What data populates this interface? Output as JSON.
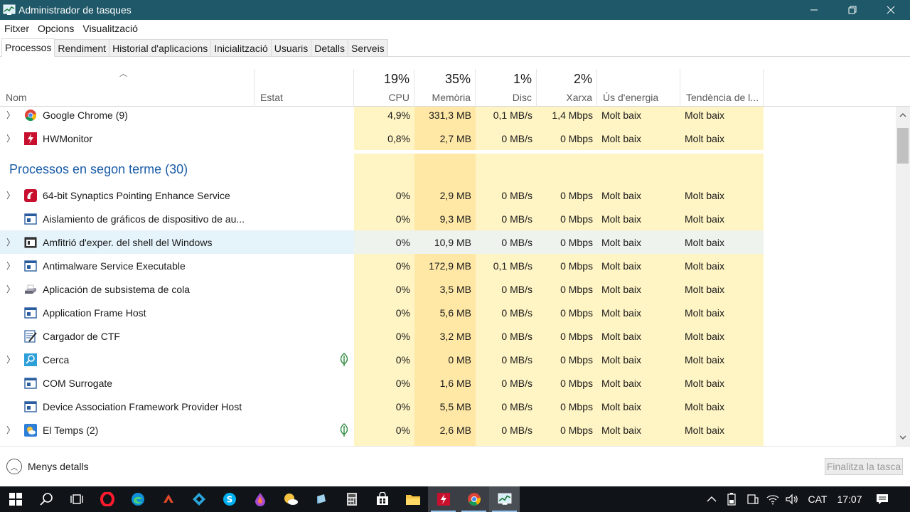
{
  "window": {
    "title": "Administrador de tasques"
  },
  "menu": [
    "Fitxer",
    "Opcions",
    "Visualització"
  ],
  "tabs": [
    "Processos",
    "Rendiment",
    "Historial d'aplicacions",
    "Inicialització",
    "Usuaris",
    "Detalls",
    "Serveis"
  ],
  "columns": {
    "name": "Nom",
    "status": "Estat",
    "cpu": {
      "pct": "19%",
      "label": "CPU"
    },
    "memory": {
      "pct": "35%",
      "label": "Memòria"
    },
    "disk": {
      "pct": "1%",
      "label": "Disc"
    },
    "network": {
      "pct": "2%",
      "label": "Xarxa"
    },
    "power": "Ús d'energia",
    "power_trend": "Tendència de l..."
  },
  "apps": [
    {
      "name": "Google Chrome (9)",
      "icon": "chrome-icon",
      "cpu": "4,9%",
      "memory": "331,3 MB",
      "disk": "0,1 MB/s",
      "network": "1,4 Mbps",
      "power": "Molt baix",
      "trend": "Molt baix"
    },
    {
      "name": "HWMonitor",
      "icon": "hwmonitor-icon",
      "cpu": "0,8%",
      "memory": "2,7 MB",
      "disk": "0 MB/s",
      "network": "0 Mbps",
      "power": "Molt baix",
      "trend": "Molt baix"
    }
  ],
  "background_group": {
    "title": "Processos en segon terme (30)"
  },
  "background": [
    {
      "name": "64-bit Synaptics Pointing Enhance Service",
      "icon": "synaptics-icon",
      "cpu": "0%",
      "memory": "2,9 MB",
      "disk": "0 MB/s",
      "network": "0 Mbps",
      "power": "Molt baix",
      "trend": "Molt baix"
    },
    {
      "name": "Aislamiento de gráficos de dispositivo de au...",
      "icon": "window-icon",
      "cpu": "0%",
      "memory": "9,3 MB",
      "disk": "0 MB/s",
      "network": "0 Mbps",
      "power": "Molt baix",
      "trend": "Molt baix"
    },
    {
      "name": "Amfitrió d'exper. del shell del Windows",
      "icon": "shell-icon",
      "cpu": "0%",
      "memory": "10,9 MB",
      "disk": "0 MB/s",
      "network": "0 Mbps",
      "power": "Molt baix",
      "trend": "Molt baix"
    },
    {
      "name": "Antimalware Service Executable",
      "icon": "window-icon",
      "cpu": "0%",
      "memory": "172,9 MB",
      "disk": "0,1 MB/s",
      "network": "0 Mbps",
      "power": "Molt baix",
      "trend": "Molt baix"
    },
    {
      "name": "Aplicación de subsistema de cola",
      "icon": "printer-icon",
      "cpu": "0%",
      "memory": "3,5 MB",
      "disk": "0 MB/s",
      "network": "0 Mbps",
      "power": "Molt baix",
      "trend": "Molt baix"
    },
    {
      "name": "Application Frame Host",
      "icon": "window-icon",
      "cpu": "0%",
      "memory": "5,6 MB",
      "disk": "0 MB/s",
      "network": "0 Mbps",
      "power": "Molt baix",
      "trend": "Molt baix"
    },
    {
      "name": "Cargador de CTF",
      "icon": "ctf-icon",
      "cpu": "0%",
      "memory": "3,2 MB",
      "disk": "0 MB/s",
      "network": "0 Mbps",
      "power": "Molt baix",
      "trend": "Molt baix"
    },
    {
      "name": "Cerca",
      "icon": "search-icon",
      "cpu": "0%",
      "memory": "0 MB",
      "disk": "0 MB/s",
      "network": "0 Mbps",
      "power": "Molt baix",
      "trend": "Molt baix"
    },
    {
      "name": "COM Surrogate",
      "icon": "window-icon",
      "cpu": "0%",
      "memory": "1,6 MB",
      "disk": "0 MB/s",
      "network": "0 Mbps",
      "power": "Molt baix",
      "trend": "Molt baix"
    },
    {
      "name": "Device Association Framework Provider Host",
      "icon": "window-icon",
      "cpu": "0%",
      "memory": "5,5 MB",
      "disk": "0 MB/s",
      "network": "0 Mbps",
      "power": "Molt baix",
      "trend": "Molt baix"
    },
    {
      "name": "El Temps (2)",
      "icon": "weather-icon",
      "cpu": "0%",
      "memory": "2,6 MB",
      "disk": "0 MB/s",
      "network": "0 Mbps",
      "power": "Molt baix",
      "trend": "Molt baix"
    }
  ],
  "footer": {
    "less_details": "Menys detalls",
    "end_task": "Finalitza la tasca"
  },
  "taskbar": {
    "lang": "CAT",
    "time": "17:07"
  }
}
